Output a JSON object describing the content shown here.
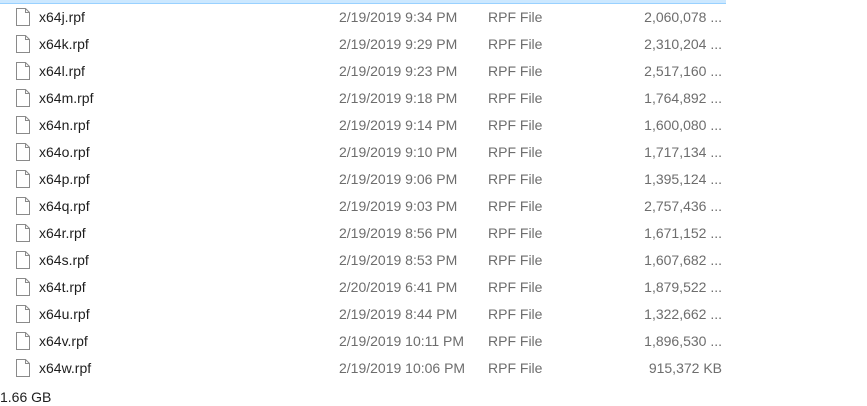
{
  "files": [
    {
      "name": "x64j.rpf",
      "date": "2/19/2019 9:34 PM",
      "type": "RPF File",
      "size": "2,060,078 ..."
    },
    {
      "name": "x64k.rpf",
      "date": "2/19/2019 9:29 PM",
      "type": "RPF File",
      "size": "2,310,204 ..."
    },
    {
      "name": "x64l.rpf",
      "date": "2/19/2019 9:23 PM",
      "type": "RPF File",
      "size": "2,517,160 ..."
    },
    {
      "name": "x64m.rpf",
      "date": "2/19/2019 9:18 PM",
      "type": "RPF File",
      "size": "1,764,892 ..."
    },
    {
      "name": "x64n.rpf",
      "date": "2/19/2019 9:14 PM",
      "type": "RPF File",
      "size": "1,600,080 ..."
    },
    {
      "name": "x64o.rpf",
      "date": "2/19/2019 9:10 PM",
      "type": "RPF File",
      "size": "1,717,134 ..."
    },
    {
      "name": "x64p.rpf",
      "date": "2/19/2019 9:06 PM",
      "type": "RPF File",
      "size": "1,395,124 ..."
    },
    {
      "name": "x64q.rpf",
      "date": "2/19/2019 9:03 PM",
      "type": "RPF File",
      "size": "2,757,436 ..."
    },
    {
      "name": "x64r.rpf",
      "date": "2/19/2019 8:56 PM",
      "type": "RPF File",
      "size": "1,671,152 ..."
    },
    {
      "name": "x64s.rpf",
      "date": "2/19/2019 8:53 PM",
      "type": "RPF File",
      "size": "1,607,682 ..."
    },
    {
      "name": "x64t.rpf",
      "date": "2/20/2019 6:41 PM",
      "type": "RPF File",
      "size": "1,879,522 ..."
    },
    {
      "name": "x64u.rpf",
      "date": "2/19/2019 8:44 PM",
      "type": "RPF File",
      "size": "1,322,662 ..."
    },
    {
      "name": "x64v.rpf",
      "date": "2/19/2019 10:11 PM",
      "type": "RPF File",
      "size": "1,896,530 ..."
    },
    {
      "name": "x64w.rpf",
      "date": "2/19/2019 10:06 PM",
      "type": "RPF File",
      "size": "915,372 KB"
    }
  ],
  "file_icon": "document-icon",
  "status_bar": {
    "selection_size": "1.66 GB"
  }
}
